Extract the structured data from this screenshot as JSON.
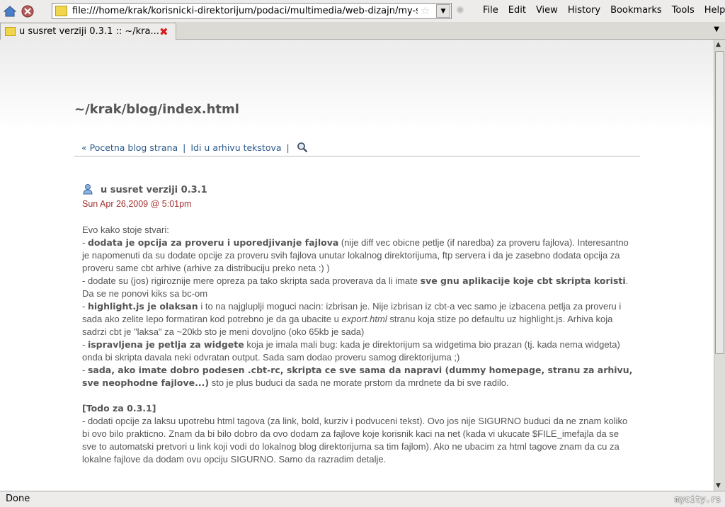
{
  "browser": {
    "url": "file:///home/krak/korisnicki-direktorijum/podaci/multimedia/web-dizajn/my-sa",
    "menu": [
      "File",
      "Edit",
      "View",
      "History",
      "Bookmarks",
      "Tools",
      "Help"
    ],
    "tab_title": "u susret verziji 0.3.1 :: ~/kra...",
    "status": "Done",
    "watermark": "mycity.rs"
  },
  "page": {
    "blog_title": "~/krak/blog/index.html",
    "nav_links": [
      "« Pocetna blog strana",
      "Idi u arhivu tekstova"
    ],
    "post": {
      "title": "u susret verziji 0.3.1",
      "date": "Sun Apr 26,2009 @ 5:01pm",
      "paragraphs": [
        [
          {
            "t": "Evo kako stoje stvari:"
          },
          {
            "br": true
          },
          {
            "t": "- "
          },
          {
            "t": "dodata je opcija za proveru i uporedjivanje fajlova",
            "s": "b"
          },
          {
            "t": " (nije diff vec obicne petlje (if naredba) za proveru fajlova). Interesantno je napomenuti da su dodate opcije za proveru svih fajlova unutar lokalnog direktorijuma, ftp servera i da je zasebno dodata opcija za proveru same cbt arhive (arhive za distribuciju preko neta :) )"
          },
          {
            "br": true
          },
          {
            "t": "- dodate su (jos) rigiroznije mere opreza pa tako skripta sada proverava da li imate "
          },
          {
            "t": "sve gnu aplikacije koje cbt skripta koristi",
            "s": "b"
          },
          {
            "t": ". Da se ne ponovi kiks sa bc-om"
          },
          {
            "br": true
          },
          {
            "t": "- "
          },
          {
            "t": "highlight.js je olaksan",
            "s": "b"
          },
          {
            "t": " i to na najgluplji moguci nacin: izbrisan je. Nije izbrisan iz cbt-a vec samo je izbacena petlja za proveru i sada ako zelite lepo formatiran kod potrebno je da ga ubacite u "
          },
          {
            "t": "export.html",
            "s": "i"
          },
          {
            "t": " stranu koja stize po defaultu uz highlight.js. Arhiva koja sadrzi cbt je \"laksa\" za ~20kb sto je meni dovoljno (oko 65kb je sada)"
          },
          {
            "br": true
          },
          {
            "t": "- "
          },
          {
            "t": "ispravljena je petlja za widgete",
            "s": "b"
          },
          {
            "t": " koja je imala mali bug: kada je direktorijum sa widgetima bio prazan (tj. kada nema widgeta) onda bi skripta davala neki odvratan output. Sada sam dodao proveru samog direktorijuma ;)"
          },
          {
            "br": true
          },
          {
            "t": "- "
          },
          {
            "t": "sada, ako imate dobro podesen .cbt-rc, skripta ce sve sama da napravi (dummy homepage, stranu za arhivu, sve neophodne fajlove...)",
            "s": "b"
          },
          {
            "t": " sto je plus buduci da sada ne morate prstom da mrdnete da bi sve radilo."
          }
        ],
        [
          {
            "t": "[Todo za 0.3.1]",
            "s": "b"
          },
          {
            "br": true
          },
          {
            "t": "- dodati opcije za laksu upotrebu html tagova (za link, bold, kurziv i podvuceni tekst). Ovo jos nije SIGURNO buduci da ne znam koliko bi ovo bilo prakticno. Znam da bi bilo dobro da ovo dodam za fajlove koje korisnik kaci na net (kada vi ukucate $FILE_imefajla da se sve to automatski pretvori u link koji vodi do lokalnog blog direktorijuma sa tim fajlom). Ako ne ubacim za html tagove znam da cu za lokalne fajlove da dodam ovu opciju SIGURNO. Samo da razradim detalje."
          }
        ]
      ]
    }
  }
}
